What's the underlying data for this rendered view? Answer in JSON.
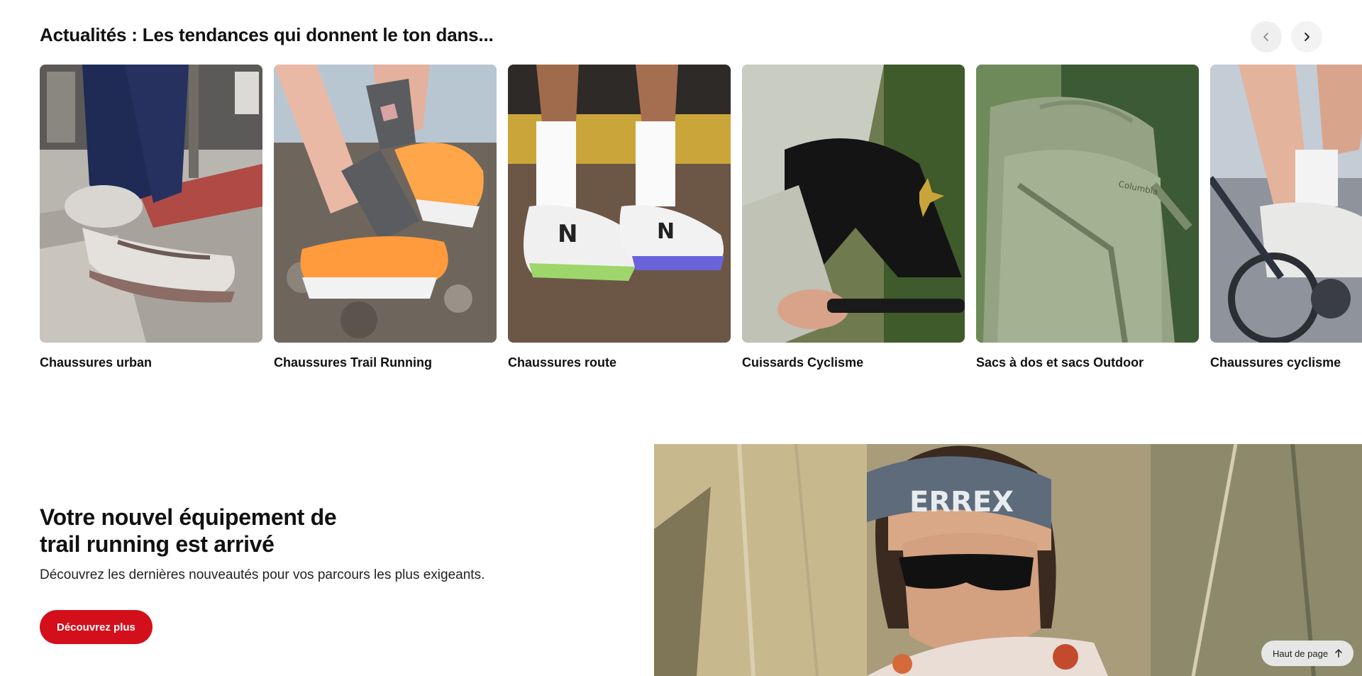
{
  "trends": {
    "title": "Actualités : Les tendances qui donnent le ton dans...",
    "prev_icon": "chevron-left-icon",
    "next_icon": "chevron-right-icon",
    "cards": [
      {
        "label": "Chaussures urban"
      },
      {
        "label": "Chaussures Trail Running"
      },
      {
        "label": "Chaussures route"
      },
      {
        "label": "Cuissards Cyclisme"
      },
      {
        "label": "Sacs à dos et sacs Outdoor"
      },
      {
        "label": "Chaussures cyclisme"
      }
    ]
  },
  "promo": {
    "heading_line1": "Votre nouvel équipement de",
    "heading_line2": "trail running est arrivé",
    "subtitle": "Découvrez les dernières nouveautés pour vos parcours les plus exigeants.",
    "button_label": "Découvrez plus",
    "hero_headband_text": "ERREX"
  },
  "back_to_top": {
    "label": "Haut de page",
    "icon": "arrow-up-icon"
  },
  "colors": {
    "accent": "#d40f1c",
    "text": "#111111",
    "button_bg": "#efefef"
  }
}
